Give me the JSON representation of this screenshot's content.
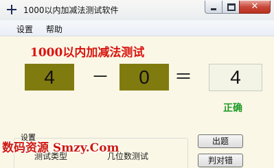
{
  "window": {
    "title": "1000以内加减法测试软件",
    "controls": {
      "close_glyph": "✕"
    }
  },
  "menu": {
    "items": [
      "设置",
      "帮助"
    ]
  },
  "main": {
    "heading": "1000以内加减法测试",
    "operand1": "4",
    "operator": "－",
    "operand2": "0",
    "equals": "＝",
    "answer": "4",
    "result": "正确"
  },
  "settings": {
    "group_label": "设置",
    "test_type_label": "测试类型",
    "digits_label": "几位数测试"
  },
  "buttons": {
    "generate": "出题",
    "check": "判对错"
  },
  "watermark": {
    "text": "数码资源 Smzy.Com"
  },
  "colors": {
    "heading": "#d8130f",
    "operand_box": "#807b0f",
    "correct": "#1c9a26",
    "watermark": "#cc1a10"
  },
  "icons": {
    "app": "plus-icon",
    "minimize": "minimize-icon",
    "maximize": "maximize-icon",
    "close": "close-icon"
  }
}
